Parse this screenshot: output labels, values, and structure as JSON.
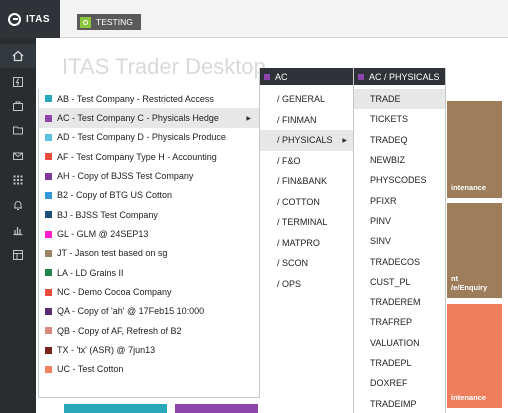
{
  "app": {
    "logo_text": "ITAS",
    "environment_badge": "TESTING"
  },
  "desktop": {
    "title": "ITAS Trader Desktop",
    "tiles": [
      {
        "text": "intenance",
        "color": "#9e7d5a"
      },
      {
        "text": "nt\n/e/Enquiry",
        "color": "#9e7d5a"
      },
      {
        "text": "intenance",
        "color": "#ef7f5c"
      }
    ]
  },
  "rail": {
    "icons": [
      "home-icon",
      "lightning-icon",
      "briefcase-icon",
      "folder-icon",
      "mail-icon",
      "grid-icon",
      "bell-icon",
      "bar-chart-icon",
      "layout-icon"
    ]
  },
  "companies": [
    {
      "label": "AB - Test Company - Restricted Access",
      "color": "#2aa7b8"
    },
    {
      "label": "AC - Test Company C - Physicals Hedge",
      "color": "#8e44ad",
      "highlight": true,
      "has_submenu": true
    },
    {
      "label": "AD - Test Company D - Physicals  Produce",
      "color": "#5bc0de"
    },
    {
      "label": "AF - Test Company Type H - Accounting",
      "color": "#e74c3c"
    },
    {
      "label": "AH - Copy of BJSS Test Company",
      "color": "#7d3c98"
    },
    {
      "label": "B2 - Copy of BTG US Cotton",
      "color": "#3498db"
    },
    {
      "label": "BJ - BJSS Test Company",
      "color": "#1f4e79"
    },
    {
      "label": "GL - GLM @ 24SEP13",
      "color": "#ff1dce"
    },
    {
      "label": "JT - Jason test based on sg",
      "color": "#9c8566"
    },
    {
      "label": "LA - LD Grains II",
      "color": "#1e8449"
    },
    {
      "label": "NC - Demo Cocoa Company",
      "color": "#e74c3c"
    },
    {
      "label": "QA - Copy of 'ah' @ 17Feb15 10:000",
      "color": "#5b2c6f"
    },
    {
      "label": "QB - Copy of AF, Refresh of  B2",
      "color": "#d98880"
    },
    {
      "label": "TX - 'tx' (ASR) @ 7jun13",
      "color": "#7b241c"
    },
    {
      "label": "UC - Test Cotton",
      "color": "#f08060"
    }
  ],
  "submenu": {
    "header": "AC",
    "items": [
      {
        "label": "/ GENERAL"
      },
      {
        "label": "/ FINMAN"
      },
      {
        "label": "/ PHYSICALS",
        "highlight": true,
        "has_submenu": true
      },
      {
        "label": "/ F&O"
      },
      {
        "label": "/ FIN&BANK"
      },
      {
        "label": "/ COTTON"
      },
      {
        "label": "/ TERMINAL"
      },
      {
        "label": "/ MATPRO"
      },
      {
        "label": "/ SCON"
      },
      {
        "label": "/ OPS"
      }
    ]
  },
  "submenu3": {
    "header": "AC / PHYSICALS",
    "items": [
      {
        "label": "TRADE",
        "highlight": true
      },
      {
        "label": "TICKETS"
      },
      {
        "label": "TRADEQ"
      },
      {
        "label": "NEWBIZ"
      },
      {
        "label": "PHYSCODES"
      },
      {
        "label": "PFIXR"
      },
      {
        "label": "PINV"
      },
      {
        "label": "SINV"
      },
      {
        "label": "TRADECOS"
      },
      {
        "label": "CUST_PL"
      },
      {
        "label": "TRADEREM"
      },
      {
        "label": "TRAFREP"
      },
      {
        "label": "VALUATION"
      },
      {
        "label": "TRADEPL"
      },
      {
        "label": "DOXREF"
      },
      {
        "label": "TRADEIMP"
      }
    ]
  },
  "arrow_glyph": "▶",
  "bottom_strips": [
    {
      "color": "#2aa7b8"
    },
    {
      "color": "#8e44ad"
    }
  ]
}
